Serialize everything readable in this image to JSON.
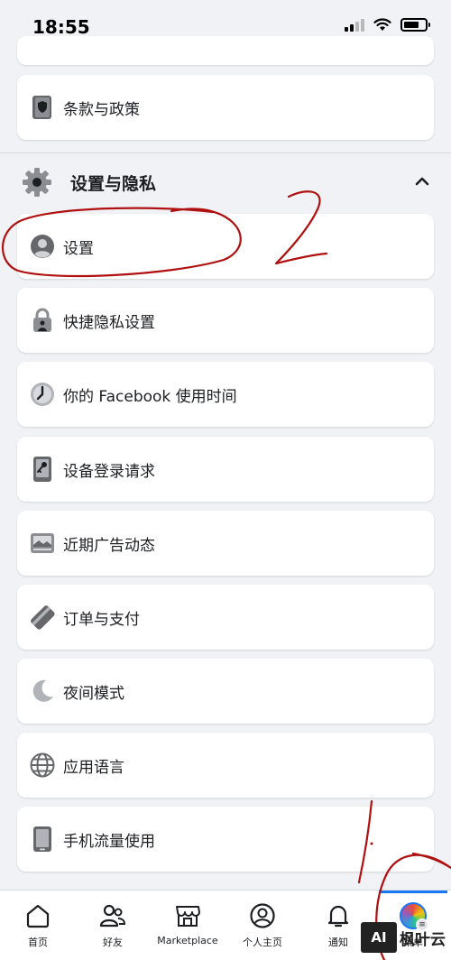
{
  "status_bar": {
    "time": "18:55"
  },
  "menu": {
    "terms_label": "条款与政策",
    "section": {
      "title": "设置与隐私"
    },
    "items": [
      {
        "label": "设置"
      },
      {
        "label": "快捷隐私设置"
      },
      {
        "label": "你的 Facebook 使用时间"
      },
      {
        "label": "设备登录请求"
      },
      {
        "label": "近期广告动态"
      },
      {
        "label": "订单与支付"
      },
      {
        "label": "夜间模式"
      },
      {
        "label": "应用语言"
      },
      {
        "label": "手机流量使用"
      }
    ]
  },
  "tab_bar": {
    "tabs": [
      {
        "label": "首页"
      },
      {
        "label": "好友"
      },
      {
        "label": "Marketplace"
      },
      {
        "label": "个人主页"
      },
      {
        "label": "通知"
      },
      {
        "label": "菜单"
      }
    ]
  },
  "annotations": {
    "mark_2": "2",
    "mark_1": "1"
  },
  "watermark": {
    "box": "AI",
    "text": "枫叶云"
  },
  "colors": {
    "accent": "#1877f2",
    "annotation": "#b01010"
  }
}
